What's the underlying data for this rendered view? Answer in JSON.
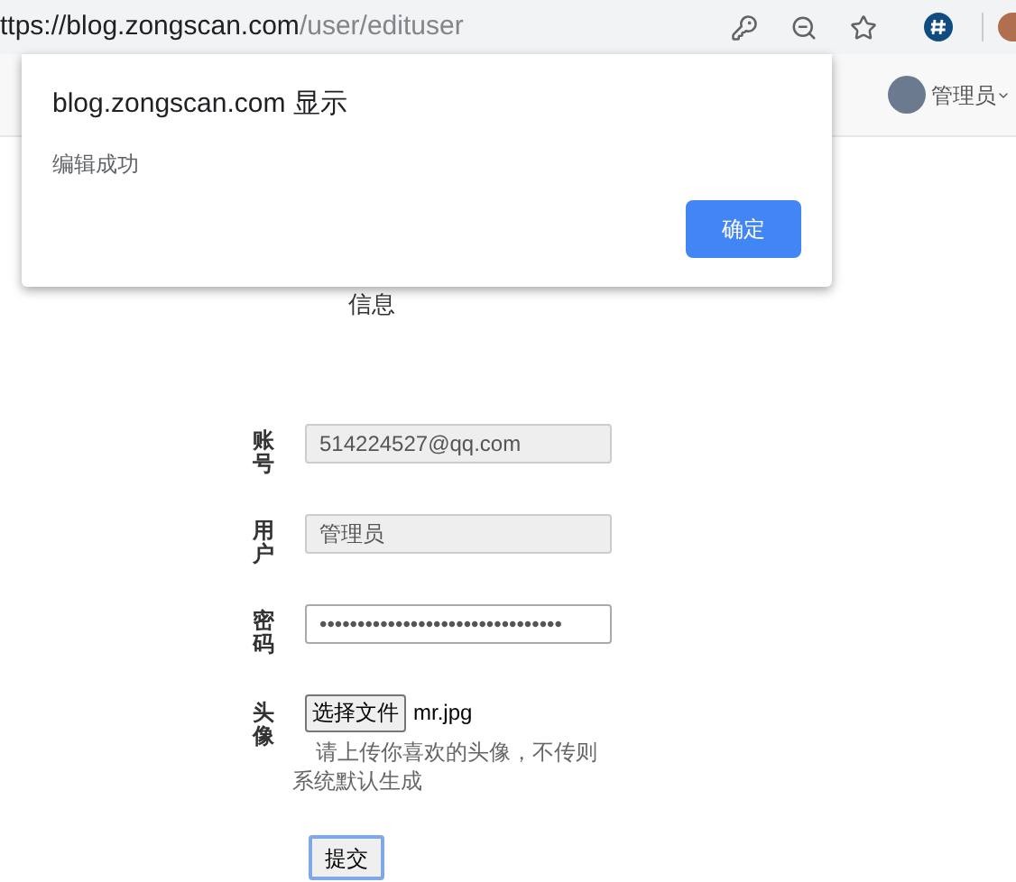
{
  "address_bar": {
    "url_host": "ttps://blog.zongscan.com",
    "url_path": "/user/edituser"
  },
  "navbar": {
    "user_name": "管理员"
  },
  "dialog": {
    "title": "blog.zongscan.com 显示",
    "message": "编辑成功",
    "button": "确定"
  },
  "page": {
    "heading_fragment": "信息"
  },
  "form": {
    "fields": [
      {
        "kind": "text",
        "label": "账号",
        "value": "514224527@qq.com",
        "disabled": true
      },
      {
        "kind": "text",
        "label": "用户",
        "value": "管理员",
        "disabled": true
      },
      {
        "kind": "password",
        "label": "密码",
        "value": "••••••••••••••••••••••••••••••••",
        "disabled": false
      },
      {
        "kind": "file",
        "label": "头像",
        "button": "选择文件",
        "file_name": "mr.jpg"
      }
    ],
    "hint": "请上传你喜欢的头像，不传则系统默认生成",
    "submit": "提交"
  }
}
